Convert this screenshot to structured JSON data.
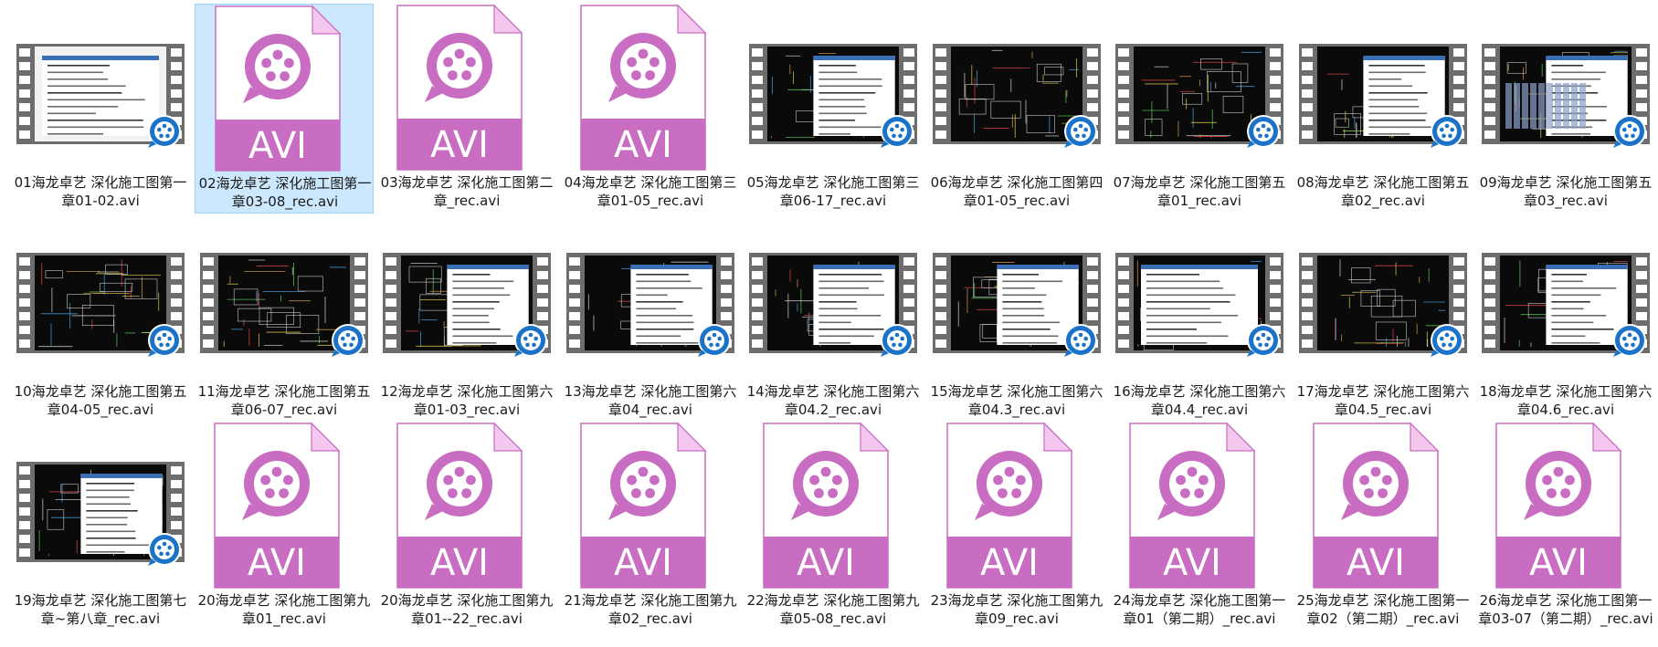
{
  "window": {
    "view": "large-icons"
  },
  "colors": {
    "avi_pink": "#c96dc2",
    "avi_pink_light": "#f4c8ee",
    "player_blue": "#1a73c8",
    "selection_bg": "#cce8ff",
    "selection_border": "#99d1ff"
  },
  "files": [
    {
      "name": "01海龙卓艺 深化施工图第一章01-02.avi",
      "kind": "video",
      "scene": "doc"
    },
    {
      "name": "02海龙卓艺 深化施工图第一章03-08_rec.avi",
      "kind": "avi",
      "selected": true
    },
    {
      "name": "03海龙卓艺 深化施工图第二章_rec.avi",
      "kind": "avi"
    },
    {
      "name": "04海龙卓艺 深化施工图第三章01-05_rec.avi",
      "kind": "avi"
    },
    {
      "name": "05海龙卓艺 深化施工图第三章06-17_rec.avi",
      "kind": "video",
      "scene": "cad-doc"
    },
    {
      "name": "06海龙卓艺 深化施工图第四章01-05_rec.avi",
      "kind": "video",
      "scene": "cad"
    },
    {
      "name": "07海龙卓艺 深化施工图第五章01_rec.avi",
      "kind": "video",
      "scene": "cad"
    },
    {
      "name": "08海龙卓艺 深化施工图第五章02_rec.avi",
      "kind": "video",
      "scene": "cad-doc"
    },
    {
      "name": "09海龙卓艺 深化施工图第五章03_rec.avi",
      "kind": "video",
      "scene": "cad-table"
    },
    {
      "name": "10海龙卓艺 深化施工图第五章04-05_rec.avi",
      "kind": "video",
      "scene": "cad"
    },
    {
      "name": "11海龙卓艺 深化施工图第五章06-07_rec.avi",
      "kind": "video",
      "scene": "cad"
    },
    {
      "name": "12海龙卓艺 深化施工图第六章01-03_rec.avi",
      "kind": "video",
      "scene": "cad-doc"
    },
    {
      "name": "13海龙卓艺 深化施工图第六章04_rec.avi",
      "kind": "video",
      "scene": "cad-doc"
    },
    {
      "name": "14海龙卓艺 深化施工图第六章04.2_rec.avi",
      "kind": "video",
      "scene": "cad-doc"
    },
    {
      "name": "15海龙卓艺 深化施工图第六章04.3_rec.avi",
      "kind": "video",
      "scene": "cad-doc"
    },
    {
      "name": "16海龙卓艺 深化施工图第六章04.4_rec.avi",
      "kind": "video",
      "scene": "doc"
    },
    {
      "name": "17海龙卓艺 深化施工图第六章04.5_rec.avi",
      "kind": "video",
      "scene": "cad"
    },
    {
      "name": "18海龙卓艺 深化施工图第六章04.6_rec.avi",
      "kind": "video",
      "scene": "cad-doc"
    },
    {
      "name": "19海龙卓艺 深化施工图第七章~第八章_rec.avi",
      "kind": "video",
      "scene": "cad-doc"
    },
    {
      "name": "20海龙卓艺 深化施工图第九章01_rec.avi",
      "kind": "avi"
    },
    {
      "name": "20海龙卓艺 深化施工图第九章01--22_rec.avi",
      "kind": "avi"
    },
    {
      "name": "21海龙卓艺 深化施工图第九章02_rec.avi",
      "kind": "avi"
    },
    {
      "name": "22海龙卓艺 深化施工图第九章05-08_rec.avi",
      "kind": "avi"
    },
    {
      "name": "23海龙卓艺 深化施工图第九章09_rec.avi",
      "kind": "avi"
    },
    {
      "name": "24海龙卓艺 深化施工图第一章01（第二期）_rec.avi",
      "kind": "avi"
    },
    {
      "name": "25海龙卓艺 深化施工图第一章02（第二期）_rec.avi",
      "kind": "avi"
    },
    {
      "name": "26海龙卓艺 深化施工图第一章03-07（第二期）_rec.avi",
      "kind": "avi"
    }
  ],
  "avi_icon_text": "AVI"
}
